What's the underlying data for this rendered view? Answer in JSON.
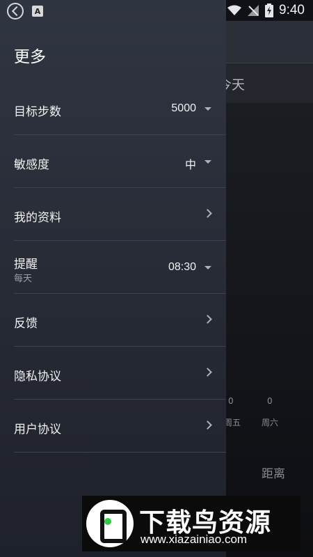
{
  "status_bar": {
    "time": "9:40"
  },
  "background": {
    "tab_today": "今天",
    "chart_values": [
      "0",
      "0"
    ],
    "chart_days": [
      "周五",
      "周六"
    ],
    "distance_label": "距离"
  },
  "drawer": {
    "title": "更多",
    "items": [
      {
        "label": "目标步数",
        "value": "5000",
        "control": "dropdown"
      },
      {
        "label": "敏感度",
        "value": "中",
        "control": "dropdown"
      },
      {
        "label": "我的资料",
        "control": "chevron"
      },
      {
        "label": "提醒",
        "sub": "每天",
        "value": "08:30",
        "control": "dropdown"
      },
      {
        "label": "反馈",
        "control": "chevron"
      },
      {
        "label": "隐私协议",
        "control": "chevron"
      },
      {
        "label": "用户协议",
        "control": "chevron"
      }
    ]
  },
  "watermark": {
    "title": "下载鸟资源",
    "url": "www.xiazainiao.com"
  }
}
